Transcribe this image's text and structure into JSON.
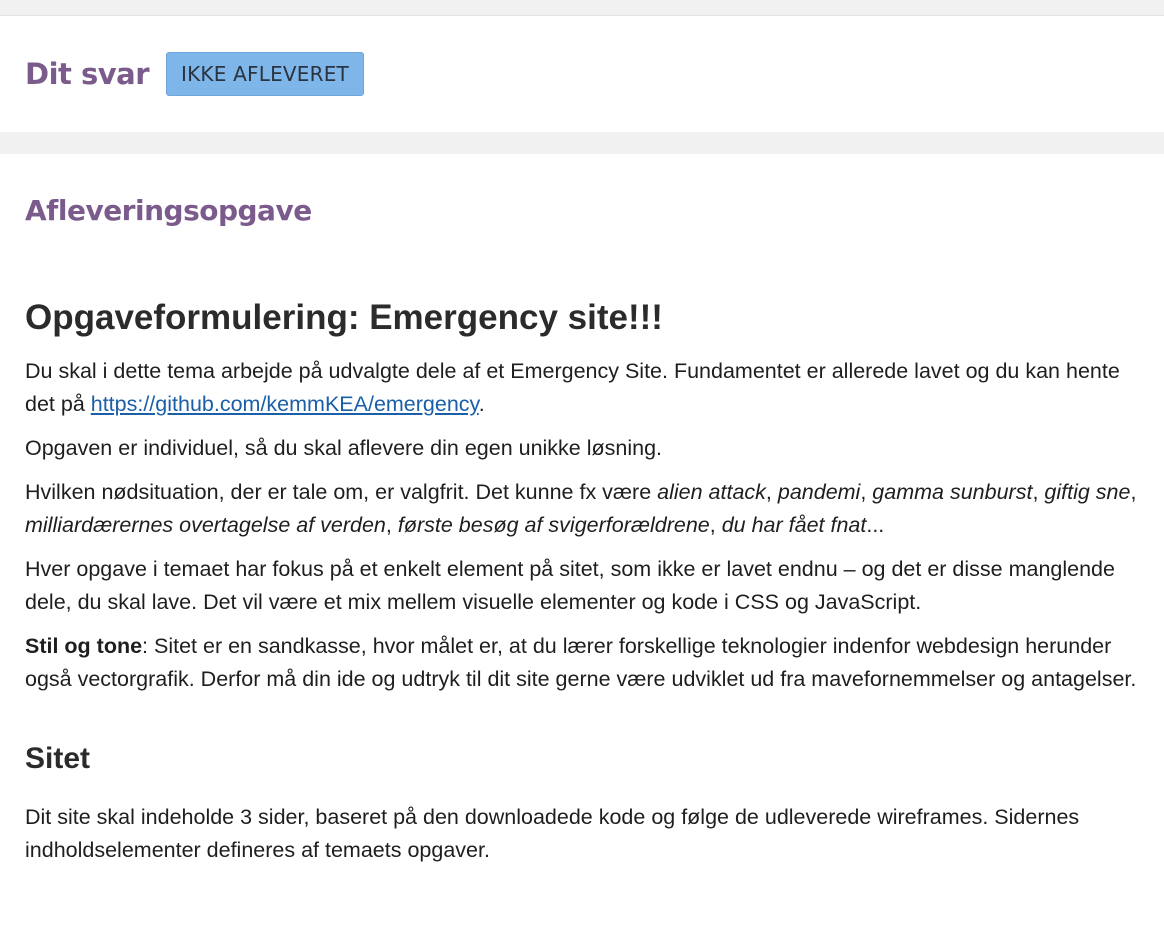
{
  "answer": {
    "title": "Dit svar",
    "status": "IKKE AFLEVERET"
  },
  "assignment": {
    "section_title": "Afleveringsopgave",
    "heading": "Opgaveformulering: Emergency site!!!",
    "p1_text": "Du skal i dette tema arbejde på udvalgte dele af et Emergency Site. Fundamentet er allerede lavet og du kan hente det på ",
    "p1_link": "https://github.com/kemmKEA/emergency",
    "p1_end": ".",
    "p2": "Opgaven er individuel, så du skal aflevere din egen unikke løsning.",
    "p3_intro": "Hvilken nødsituation, der er tale om, er valgfrit. Det kunne fx være ",
    "p3_examples": [
      "alien attack",
      "pandemi",
      "gamma sunburst",
      "giftig sne",
      "milliardærernes overtagelse af verden",
      "første besøg af svigerforældrene",
      "du har fået fnat"
    ],
    "p3_sep": ", ",
    "p3_end": "...",
    "p4": "Hver opgave i temaet har fokus på et enkelt element på sitet, som ikke er lavet endnu – og det er disse manglende dele, du skal lave. Det vil være et mix mellem visuelle elementer og kode i CSS og JavaScript.",
    "p5_label": "Stil og tone",
    "p5_text": ": Sitet er en sandkasse, hvor målet er, at du lærer forskellige teknologier indenfor webdesign herunder også vectorgrafik. Derfor må din ide og udtryk til dit site gerne være udviklet ud fra mavefornemmelser og antagelser.",
    "subheading": "Sitet",
    "p6": "Dit site skal indeholde 3 sider, baseret på den downloadede kode og følge de udleverede wireframes. Sidernes indholdselementer defineres af temaets opgaver."
  }
}
